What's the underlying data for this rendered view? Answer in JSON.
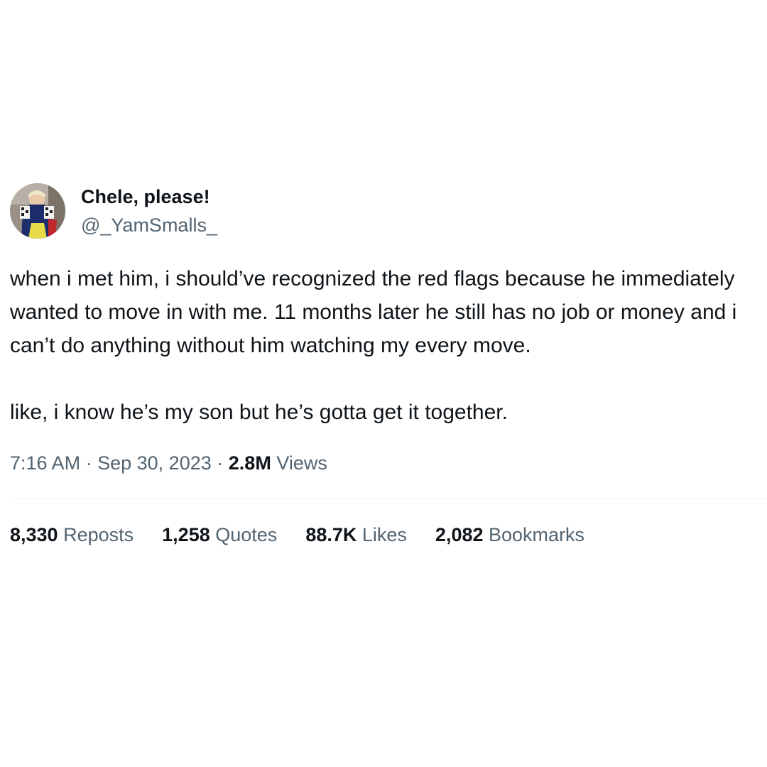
{
  "author": {
    "display_name": "Chele, please!",
    "handle": "@_YamSmalls_",
    "avatar_icon": "profile-photo"
  },
  "tweet": {
    "paragraphs": [
      "when i met him, i should’ve recognized the red flags because he immediately wanted to move in with me. 11 months later he still has no job or money and i can’t do anything without him watching my every move.",
      "like, i know he’s my son but he’s gotta get it together."
    ]
  },
  "meta": {
    "time": "7:16 AM",
    "separator": "·",
    "date": "Sep 30, 2023",
    "views_count": "2.8M",
    "views_label": "Views"
  },
  "stats": {
    "reposts": {
      "count": "8,330",
      "label": "Reposts"
    },
    "quotes": {
      "count": "1,258",
      "label": "Quotes"
    },
    "likes": {
      "count": "88.7K",
      "label": "Likes"
    },
    "bookmarks": {
      "count": "2,082",
      "label": "Bookmarks"
    }
  },
  "colors": {
    "text_primary": "#0f1419",
    "text_secondary": "#536471",
    "divider": "#eff3f4",
    "background": "#ffffff"
  }
}
